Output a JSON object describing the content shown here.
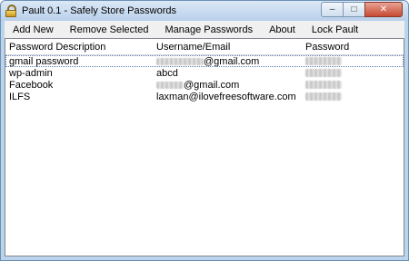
{
  "window": {
    "title": "Pault 0.1 - Safely Store Passwords"
  },
  "window_controls": {
    "minimize": "–",
    "maximize": "□",
    "close": "✕"
  },
  "menu": [
    {
      "label": "Add New"
    },
    {
      "label": "Remove Selected"
    },
    {
      "label": "Manage Passwords"
    },
    {
      "label": "About"
    },
    {
      "label": "Lock Pault"
    }
  ],
  "table": {
    "columns": [
      "Password Description",
      "Username/Email",
      "Password"
    ],
    "rows": [
      {
        "description": "gmail password",
        "username_suffix": "@gmail.com",
        "username_obscured": true,
        "password_obscured": true,
        "selected": true
      },
      {
        "description": "wp-admin",
        "username": "abcd",
        "password_obscured": true
      },
      {
        "description": "Facebook",
        "username_suffix": "@gmail.com",
        "username_obscured": true,
        "password_obscured": true
      },
      {
        "description": "ILFS",
        "username": "laxman@ilovefreesoftware.com",
        "password_obscured": true
      }
    ]
  },
  "colors": {
    "titlebar": "#bcd3ec",
    "menubar": "#f0f0f0",
    "close_button": "#c74a32"
  }
}
